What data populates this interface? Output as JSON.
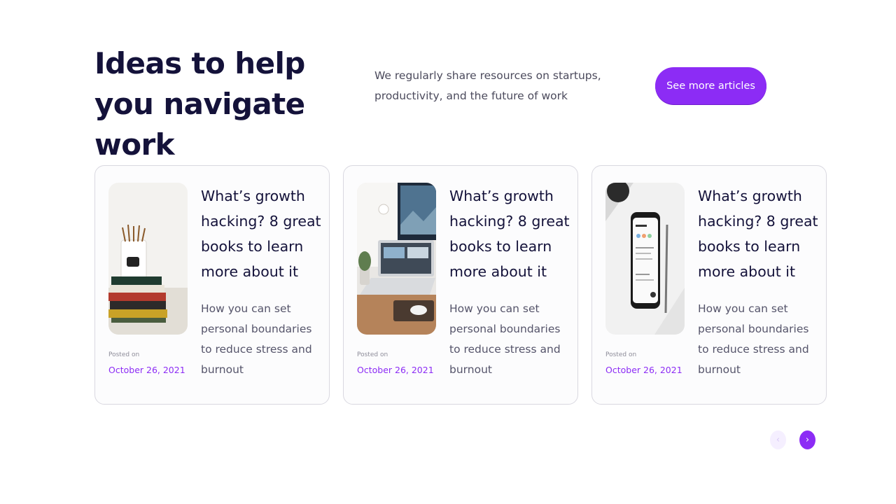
{
  "header": {
    "title": "Ideas to help you navigate work",
    "intro": "We regularly share resources on startups, productivity, and the future of work",
    "cta_label": "See more articles"
  },
  "cards": [
    {
      "image": "stacked-books-and-pencil-cup-photo",
      "posted_label": "Posted on",
      "date": "October 26, 2021",
      "title": "What’s growth hacking? 8 great books to learn more about it",
      "text": "How you can set personal boundaries to reduce stress and burnout"
    },
    {
      "image": "laptop-and-monitor-desk-photo",
      "posted_label": "Posted on",
      "date": "October 26, 2021",
      "title": "What’s growth hacking? 8 great books to learn more about it",
      "text": "How you can set personal boundaries to reduce stress and burnout"
    },
    {
      "image": "smartphone-and-pen-on-desk-photo",
      "posted_label": "Posted on",
      "date": "October 26, 2021",
      "title": "What’s growth hacking? 8 great books to learn more about it",
      "text": "How you can set personal boundaries to reduce stress and burnout"
    }
  ],
  "pager": {
    "prev_icon": "chevron-left-icon",
    "next_icon": "chevron-right-icon",
    "prev_symbol": "‹",
    "next_symbol": "›",
    "prev_state": "disabled"
  },
  "colors": {
    "accent": "#8c2cf5",
    "heading": "#14123a",
    "body_text": "#55546a",
    "card_border": "#d9d8e0"
  }
}
